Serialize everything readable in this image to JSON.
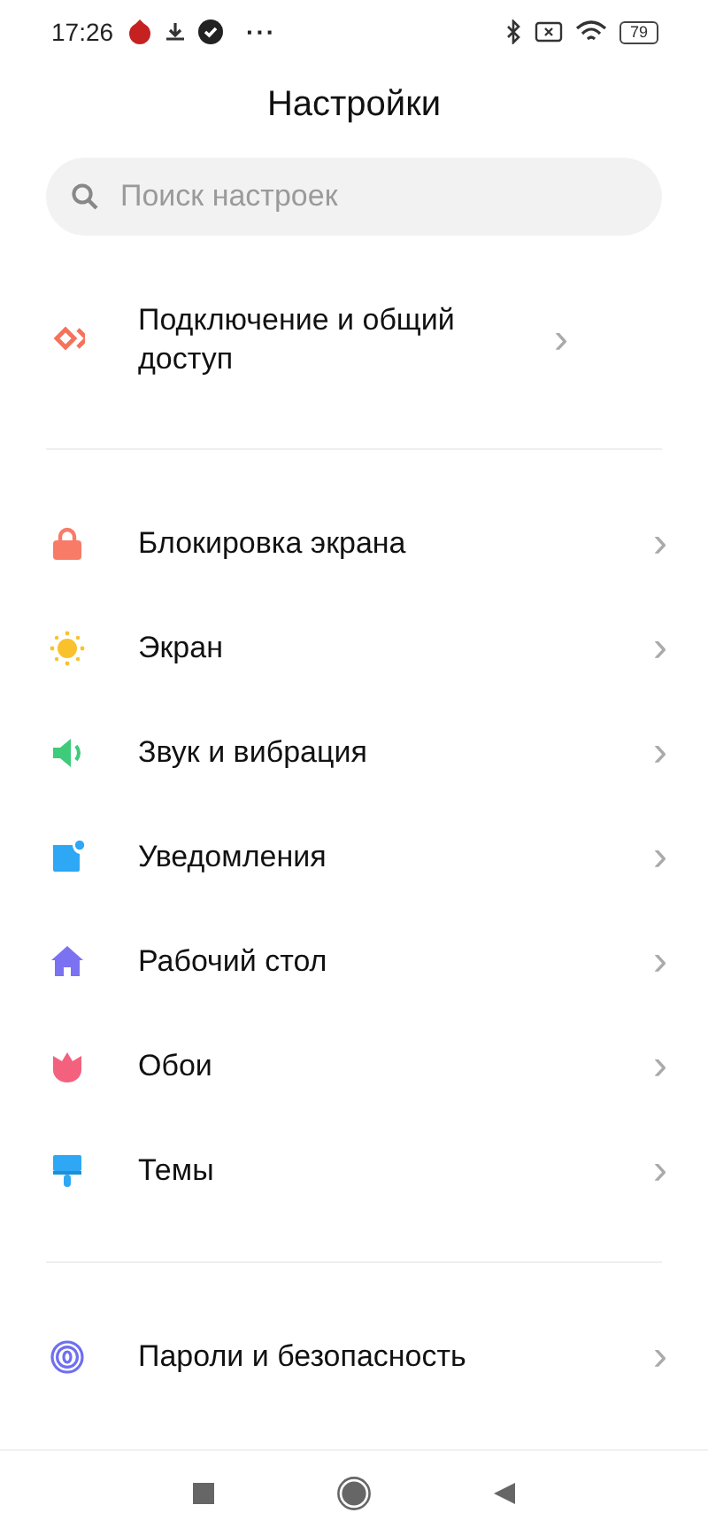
{
  "status_bar": {
    "time": "17:26",
    "more": "···",
    "battery": "79"
  },
  "title": "Настройки",
  "search": {
    "placeholder": "Поиск настроек"
  },
  "sections": [
    {
      "items": [
        {
          "label": "Подключение и общий доступ",
          "chevron": "›"
        }
      ]
    },
    {
      "items": [
        {
          "label": "Блокировка экрана",
          "chevron": "›"
        },
        {
          "label": "Экран",
          "chevron": "›"
        },
        {
          "label": "Звук и вибрация",
          "chevron": "›"
        },
        {
          "label": "Уведомления",
          "chevron": "›"
        },
        {
          "label": "Рабочий стол",
          "chevron": "›"
        },
        {
          "label": "Обои",
          "chevron": "›"
        },
        {
          "label": "Темы",
          "chevron": "›"
        }
      ]
    },
    {
      "items": [
        {
          "label": "Пароли и безопасность",
          "chevron": "›"
        }
      ]
    }
  ]
}
